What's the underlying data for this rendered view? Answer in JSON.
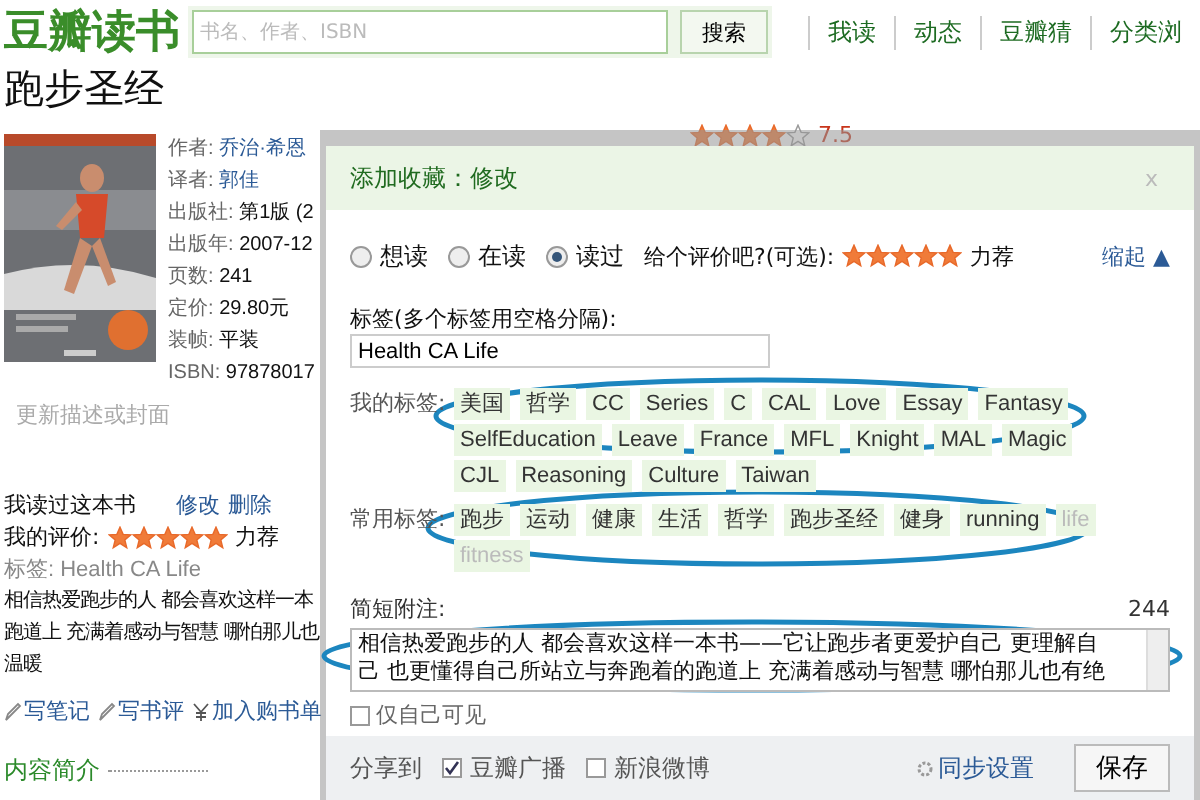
{
  "header": {
    "logo": "豆瓣读书",
    "search": {
      "placeholder": "书名、作者、ISBN",
      "button": "搜索"
    },
    "nav": [
      "我读",
      "动态",
      "豆瓣猜",
      "分类浏"
    ]
  },
  "book": {
    "title": "跑步圣经",
    "rating": {
      "stars": 4,
      "score": "7.5"
    },
    "info": [
      {
        "label": "作者:",
        "value": "乔治·希恩",
        "link": true
      },
      {
        "label": "译者:",
        "value": "郭佳",
        "link": true
      },
      {
        "label": "出版社:",
        "value": "第1版 (2",
        "link": false
      },
      {
        "label": "出版年:",
        "value": "2007-12",
        "link": false
      },
      {
        "label": "页数:",
        "value": "241",
        "link": false
      },
      {
        "label": "定价:",
        "value": "29.80元",
        "link": false
      },
      {
        "label": "装帧:",
        "value": "平装",
        "link": false
      },
      {
        "label": "ISBN:",
        "value": "97878017",
        "link": false
      }
    ],
    "update_link": "更新描述或封面",
    "my_status": {
      "text": "我读过这本书",
      "links": [
        "修改",
        "删除"
      ]
    },
    "my_rating": {
      "label": "我的评价:",
      "stars": 5,
      "verdict": "力荐"
    },
    "tags_line": "标签: Health CA Life",
    "comment_lines": [
      "相信热爱跑步的人 都会喜欢这样一本",
      "跑道上 充满着感动与智慧 哪怕那儿也",
      "温暖"
    ],
    "actions": [
      {
        "kind": "pencil",
        "label": "写笔记"
      },
      {
        "kind": "pencil",
        "label": "写书评"
      },
      {
        "kind": "yen",
        "label": "加入购书单"
      }
    ],
    "section": "内容简介"
  },
  "dialog": {
    "title": "添加收藏：修改",
    "close": "x",
    "status_options": [
      {
        "label": "想读",
        "selected": false
      },
      {
        "label": "在读",
        "selected": false
      },
      {
        "label": "读过",
        "selected": true
      }
    ],
    "rating_prompt": "给个评价吧?(可选):",
    "stars": 5,
    "verdict": "力荐",
    "collapse": "缩起 ▲",
    "tags_label": "标签(多个标签用空格分隔):",
    "tags_value": "Health CA Life",
    "my_tags": {
      "label": "我的标签:",
      "tags": [
        {
          "text": "美国",
          "dimmed": false
        },
        {
          "text": "哲学",
          "dimmed": false
        },
        {
          "text": "CC",
          "dimmed": false
        },
        {
          "text": "Series",
          "dimmed": false
        },
        {
          "text": "C",
          "dimmed": false
        },
        {
          "text": "CAL",
          "dimmed": false
        },
        {
          "text": "Love",
          "dimmed": false
        },
        {
          "text": "Essay",
          "dimmed": false
        },
        {
          "text": "Fantasy",
          "dimmed": false
        },
        {
          "text": "SelfEducation",
          "dimmed": false
        },
        {
          "text": "Leave",
          "dimmed": false
        },
        {
          "text": "France",
          "dimmed": false
        },
        {
          "text": "MFL",
          "dimmed": false
        },
        {
          "text": "Knight",
          "dimmed": false
        },
        {
          "text": "MAL",
          "dimmed": false
        },
        {
          "text": "Magic",
          "dimmed": false
        },
        {
          "text": "CJL",
          "dimmed": false
        },
        {
          "text": "Reasoning",
          "dimmed": false
        },
        {
          "text": "Culture",
          "dimmed": false
        },
        {
          "text": "Taiwan",
          "dimmed": false
        }
      ]
    },
    "common_tags": {
      "label": "常用标签:",
      "tags": [
        {
          "text": "跑步",
          "dimmed": false
        },
        {
          "text": "运动",
          "dimmed": false
        },
        {
          "text": "健康",
          "dimmed": false
        },
        {
          "text": "生活",
          "dimmed": false
        },
        {
          "text": "哲学",
          "dimmed": false
        },
        {
          "text": "跑步圣经",
          "dimmed": false
        },
        {
          "text": "健身",
          "dimmed": false
        },
        {
          "text": "running",
          "dimmed": false
        },
        {
          "text": "life",
          "dimmed": true
        },
        {
          "text": "fitness",
          "dimmed": true
        }
      ]
    },
    "note_label": "简短附注:",
    "note_count": "244",
    "note_lines": [
      "相信热爱跑步的人 都会喜欢这样一本书——它让跑步者更爱护自己 更理解自",
      "己 也更懂得自己所站立与奔跑着的跑道上 充满着感动与智慧 哪怕那儿也有绝"
    ],
    "private": {
      "label": "仅自己可见",
      "checked": false
    },
    "share_label": "分享到",
    "share_options": [
      {
        "label": "豆瓣广播",
        "checked": true
      },
      {
        "label": "新浪微博",
        "checked": false
      }
    ],
    "sync": "同步设置",
    "save": "保存"
  }
}
